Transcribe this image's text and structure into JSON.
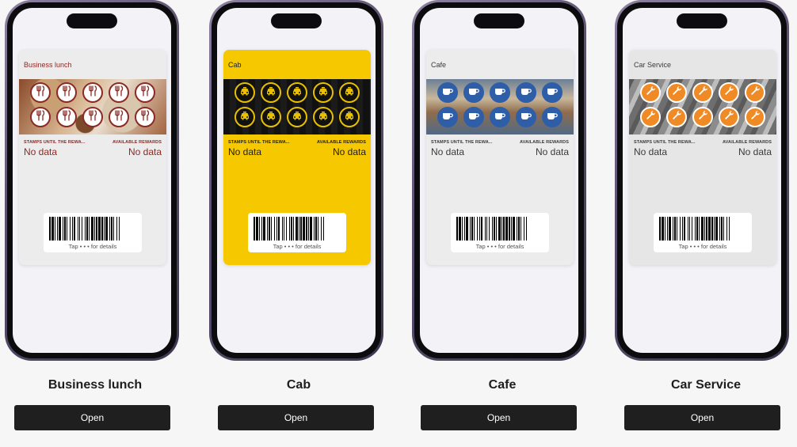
{
  "cards": [
    {
      "name": "Business lunch",
      "pass_title": "Business lunch",
      "stamps_label": "STAMPS UNTIL THE REWA...",
      "stamps_value": "No data",
      "rewards_label": "AVAILABLE REWARDS",
      "rewards_value": "No data",
      "barcode_caption": "Tap • • • for details",
      "open_label": "Open",
      "colors": {
        "card": "#ececec",
        "title": "#8b2a24",
        "label": "#8b2a24",
        "value": "#8b2a24",
        "stamp_fill": "#ffffff",
        "stamp_ring": "#8b2a24",
        "icon": "#8b2a24"
      },
      "stamp_icon": "utensils-icon",
      "strip_theme": "food"
    },
    {
      "name": "Cab",
      "pass_title": "Cab",
      "stamps_label": "STAMPS UNTIL THE REWA...",
      "stamps_value": "No data",
      "rewards_label": "AVAILABLE REWARDS",
      "rewards_value": "No data",
      "barcode_caption": "Tap • • • for details",
      "open_label": "Open",
      "colors": {
        "card": "#f6c800",
        "title": "#1d1d1f",
        "label": "#1d1d1f",
        "value": "#1d1d1f",
        "stamp_fill": "#111111",
        "stamp_ring": "#e8c000",
        "icon": "#e8c000"
      },
      "stamp_icon": "taxi-icon",
      "strip_theme": "taxi"
    },
    {
      "name": "Cafe",
      "pass_title": "Cafe",
      "stamps_label": "STAMPS UNTIL THE REWA...",
      "stamps_value": "No data",
      "rewards_label": "AVAILABLE REWARDS",
      "rewards_value": "No data",
      "barcode_caption": "Tap • • • for details",
      "open_label": "Open",
      "colors": {
        "card": "#ececec",
        "title": "#3a3a3c",
        "label": "#3a3a3c",
        "value": "#3a3a3c",
        "stamp_fill": "#2f5ea8",
        "stamp_ring": "#2f5ea8",
        "icon": "#ffffff"
      },
      "stamp_icon": "coffee-cup-icon",
      "strip_theme": "cafe"
    },
    {
      "name": "Car Service",
      "pass_title": "Car Service",
      "stamps_label": "STAMPS UNTIL THE REWA...",
      "stamps_value": "No data",
      "rewards_label": "AVAILABLE REWARDS",
      "rewards_value": "No data",
      "barcode_caption": "Tap • • • for details",
      "open_label": "Open",
      "colors": {
        "card": "#e6e6e6",
        "title": "#3a3a3c",
        "label": "#3a3a3c",
        "value": "#3a3a3c",
        "stamp_fill": "#f08a24",
        "stamp_ring": "#ffffff",
        "icon": "#ffffff"
      },
      "stamp_icon": "wrench-icon",
      "strip_theme": "metal"
    }
  ]
}
